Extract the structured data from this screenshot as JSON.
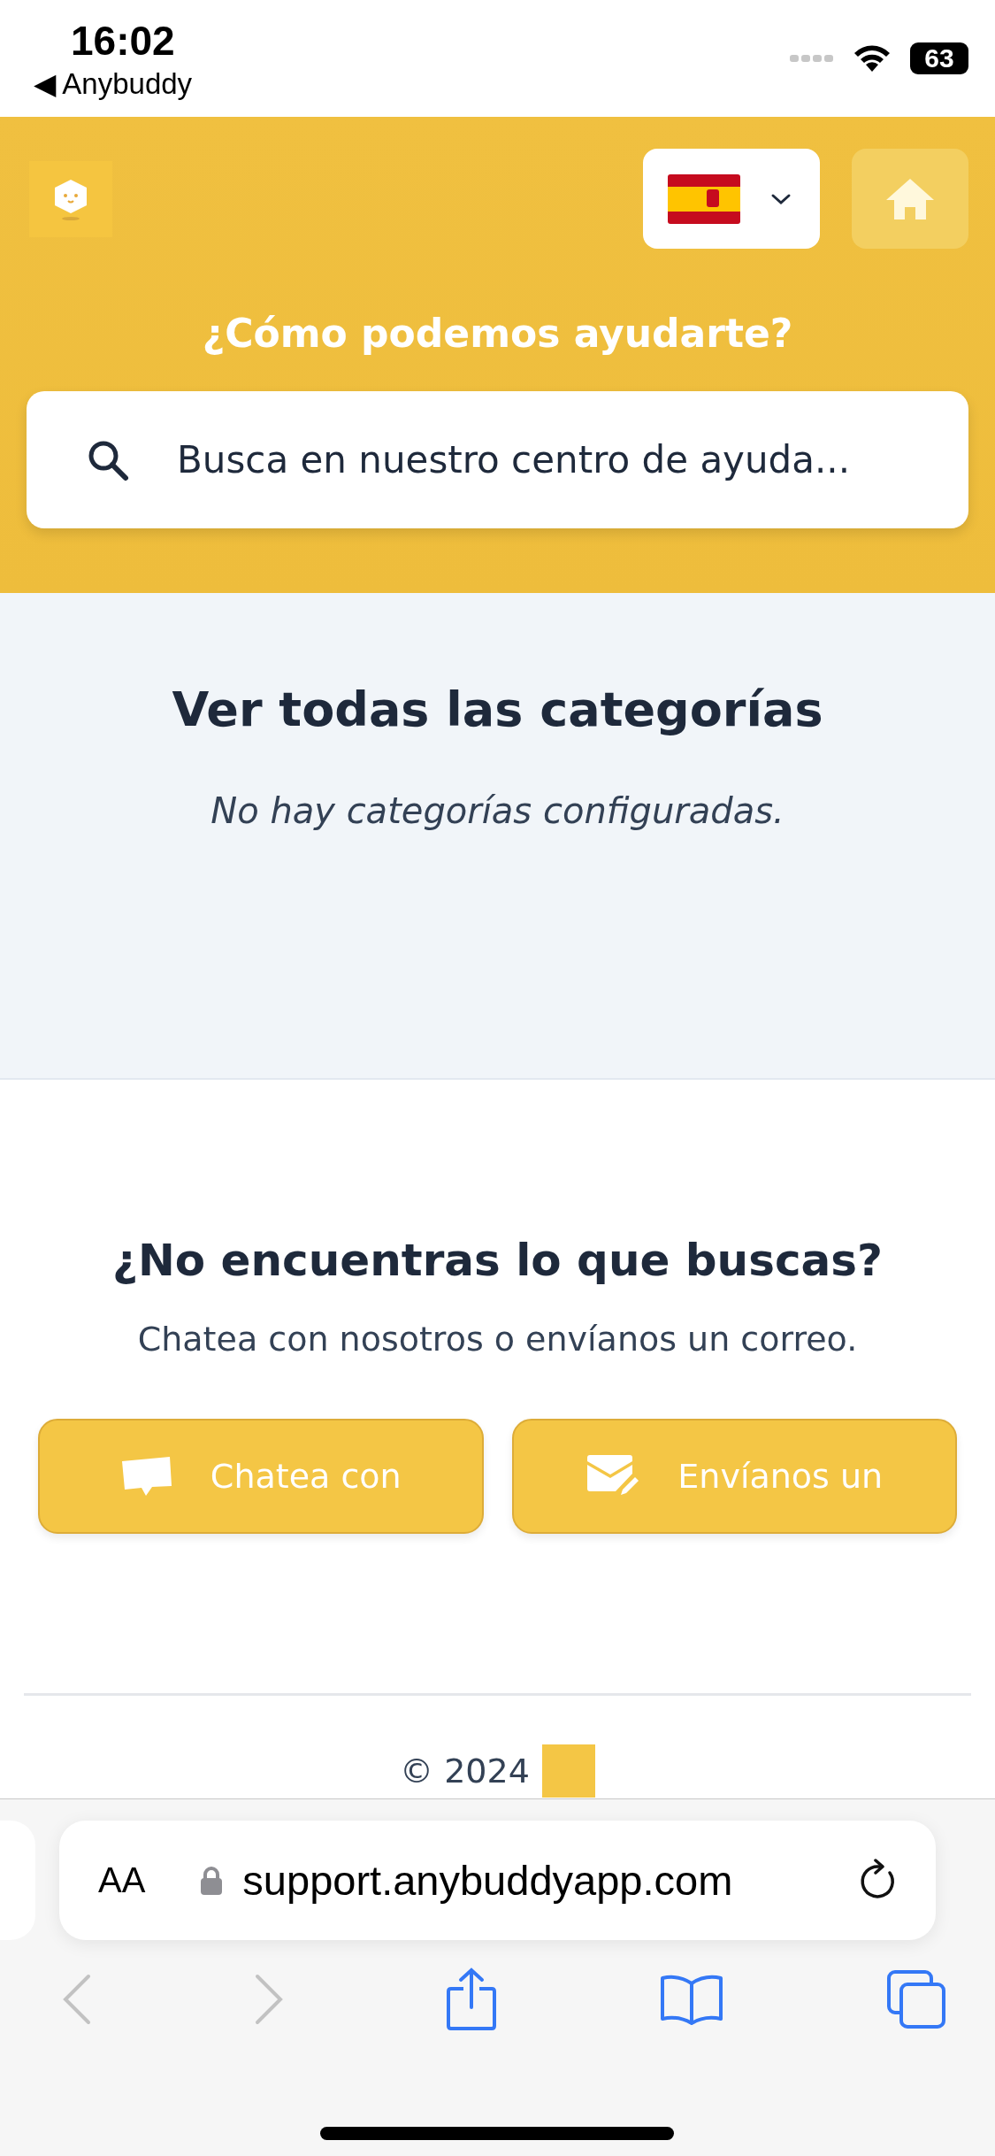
{
  "status_bar": {
    "time": "16:02",
    "back_app": "◀ Anybuddy",
    "battery": "63"
  },
  "header": {
    "title": "¿Cómo podemos ayudarte?",
    "search": {
      "placeholder": "Busca en nuestro centro de ayuda..."
    }
  },
  "categories": {
    "title": "Ver todas las categorías",
    "empty_message": "No hay categorías configuradas."
  },
  "contact": {
    "title": "¿No encuentras lo que buscas?",
    "subtitle": "Chatea con nosotros o envíanos un correo.",
    "buttons": [
      {
        "kind": "chat",
        "label": "Chatea con"
      },
      {
        "kind": "email",
        "label": "Envíanos un"
      }
    ]
  },
  "footer": {
    "copyright": "© 2024"
  },
  "browser": {
    "text_size": "AA",
    "url": "support.anybuddyapp.com"
  }
}
